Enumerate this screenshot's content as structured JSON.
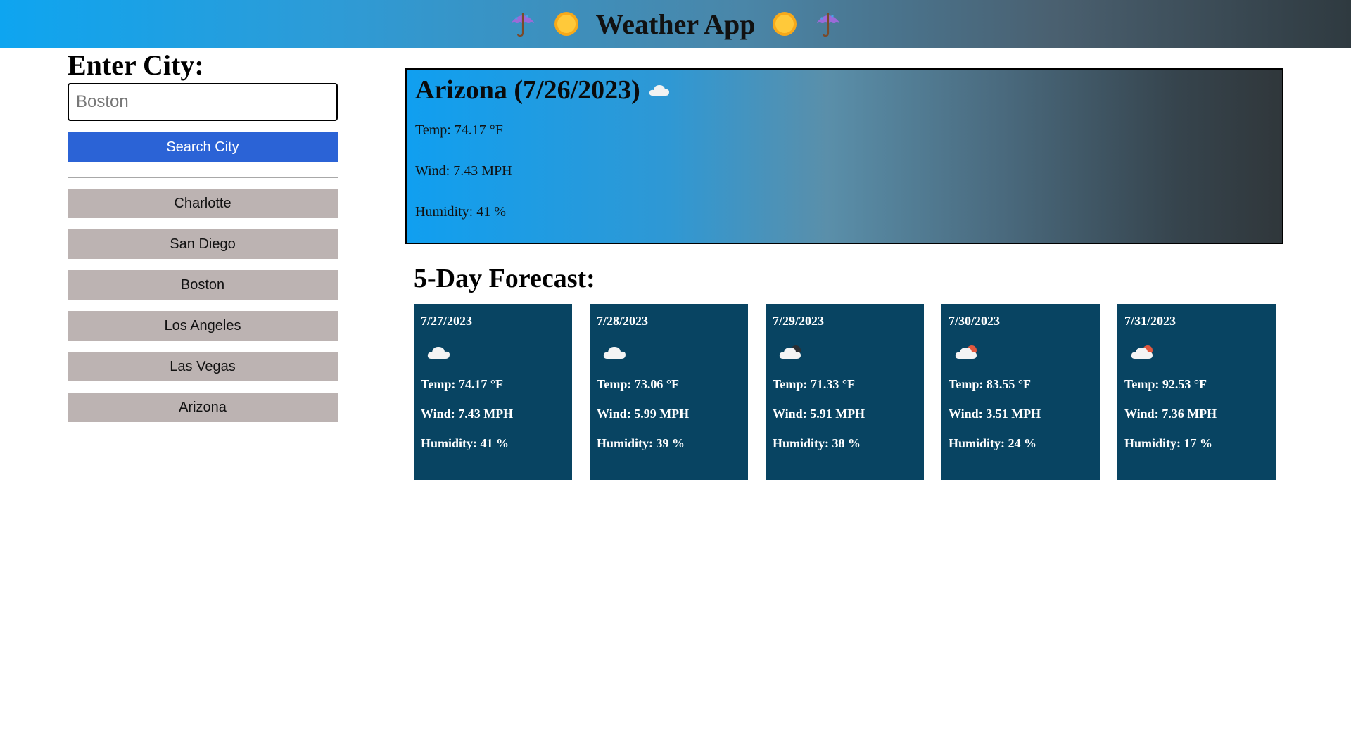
{
  "header": {
    "title": "Weather App",
    "icons": [
      "umbrella-icon",
      "sun-icon",
      "sun-icon",
      "umbrella-icon"
    ]
  },
  "sidebar": {
    "heading": "Enter City:",
    "input_placeholder": "Boston",
    "search_label": "Search City",
    "history": [
      "Charlotte",
      "San Diego",
      "Boston",
      "Los Angeles",
      "Las Vegas",
      "Arizona"
    ]
  },
  "current": {
    "title": "Arizona (7/26/2023)",
    "icon": "cloud-icon",
    "temp": "Temp: 74.17 °F",
    "wind": "Wind: 7.43 MPH",
    "humidity": "Humidity: 41 %"
  },
  "forecast": {
    "title": "5-Day Forecast:",
    "days": [
      {
        "date": "7/27/2023",
        "icon": "cloud-icon",
        "temp": "Temp: 74.17 °F",
        "wind": "Wind: 7.43 MPH",
        "humidity": "Humidity: 41 %"
      },
      {
        "date": "7/28/2023",
        "icon": "cloud-icon",
        "temp": "Temp: 73.06 °F",
        "wind": "Wind: 5.99 MPH",
        "humidity": "Humidity: 39 %"
      },
      {
        "date": "7/29/2023",
        "icon": "cloud-night-icon",
        "temp": "Temp: 71.33 °F",
        "wind": "Wind: 5.91 MPH",
        "humidity": "Humidity: 38 %"
      },
      {
        "date": "7/30/2023",
        "icon": "cloud-sun-icon",
        "temp": "Temp: 83.55 °F",
        "wind": "Wind: 3.51 MPH",
        "humidity": "Humidity: 24 %"
      },
      {
        "date": "7/31/2023",
        "icon": "cloud-sun-icon",
        "temp": "Temp: 92.53 °F",
        "wind": "Wind: 7.36 MPH",
        "humidity": "Humidity: 17 %"
      }
    ]
  },
  "colors": {
    "search_button": "#2b63d6",
    "history_button": "#bcb3b2",
    "card_background": "#084462"
  }
}
